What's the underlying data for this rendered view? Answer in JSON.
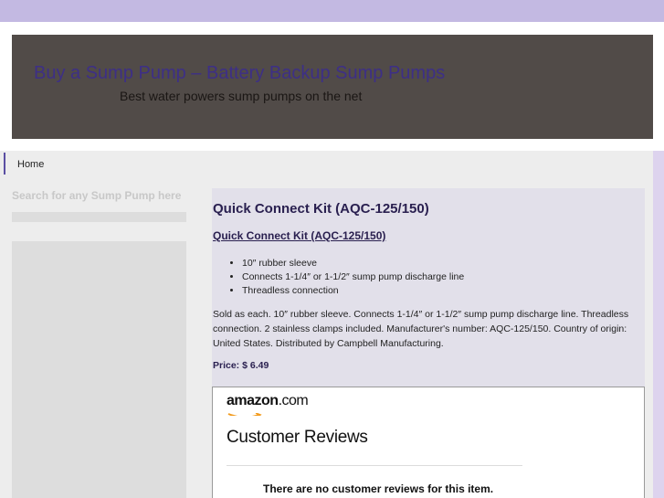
{
  "header": {
    "title": "Buy a Sump Pump – Battery Backup Sump Pumps",
    "tagline": "Best water powers sump pumps on the net"
  },
  "nav": {
    "home": "Home"
  },
  "sidebar": {
    "search_heading": "Search for any Sump Pump here"
  },
  "post": {
    "title": "Quick Connect Kit (AQC-125/150)",
    "link": "Quick Connect Kit (AQC-125/150)",
    "features": [
      "10″ rubber sleeve",
      "Connects 1-1/4″ or 1-1/2″ sump pump discharge line",
      "Threadless connection"
    ],
    "description": "Sold as each. 10″ rubber sleeve. Connects 1-1/4″ or 1-1/2″ sump pump discharge line. Threadless connection. 2 stainless clamps included. Manufacturer's number: AQC-125/150. Country of origin: United States. Distributed by Campbell Manufacturing.",
    "price_label": "Price: $ 6.49"
  },
  "reviews": {
    "logo_bold": "amazon",
    "logo_rest": ".com",
    "heading": "Customer Reviews",
    "empty_message": "There are no customer reviews for this item."
  },
  "colors": {
    "top_strip": "#c3b9e2",
    "header_bg": "#514b48",
    "title": "#3d2f86",
    "accent_text": "#2a2050",
    "amazon_orange": "#f29b1d"
  }
}
